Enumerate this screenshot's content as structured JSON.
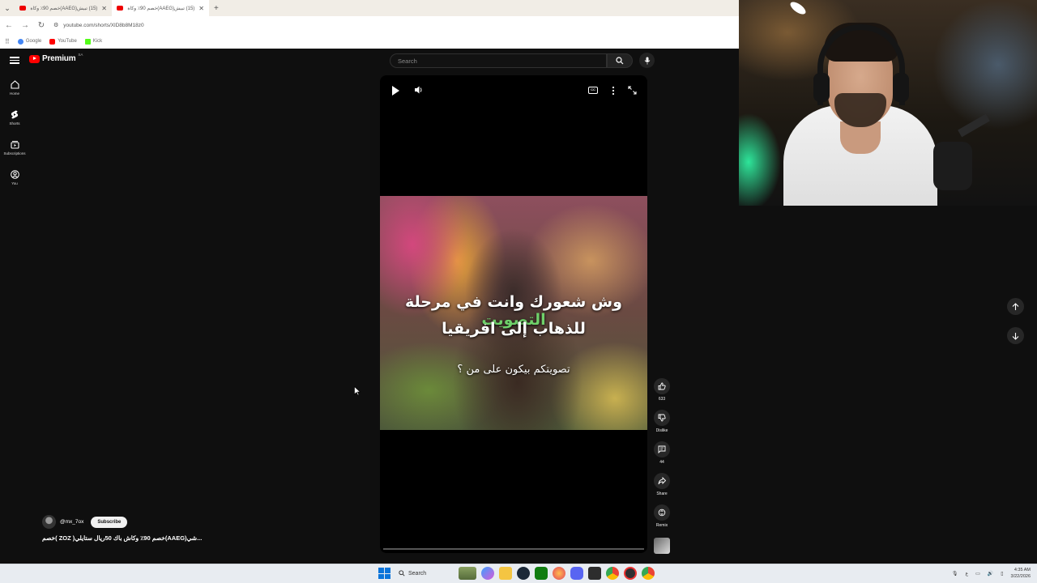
{
  "browser": {
    "tabs": [
      {
        "title": "(15) تبيش(AAEG)خصم 90٪ وكاة"
      },
      {
        "title": "(15) تبيش(AAEG)خصم 90٪ وكاة"
      }
    ],
    "new_tab": "+",
    "url": "youtube.com/shorts/XlD8b8M18z0",
    "bookmarks": [
      {
        "label": "Google",
        "color": "#4285f4"
      },
      {
        "label": "YouTube",
        "color": "#ff0000"
      },
      {
        "label": "Kick",
        "color": "#53fc18"
      }
    ]
  },
  "header": {
    "logo_text": "Premium",
    "region": "SA",
    "search_placeholder": "Search"
  },
  "sidebar": {
    "items": [
      {
        "label": "Home",
        "icon": "home-icon"
      },
      {
        "label": "Shorts",
        "icon": "shorts-icon"
      },
      {
        "label": "Subscriptions",
        "icon": "subscriptions-icon"
      },
      {
        "label": "You",
        "icon": "you-icon"
      }
    ]
  },
  "player": {
    "cc_label": "CC",
    "caption_line1_start": "وش شعورك وانت في مرحلة ",
    "caption_line1_highlight": "التصويت",
    "caption_line2": "للذهاب إلى افريقيا",
    "caption_line3": "تصويتكم بيكون على من ؟",
    "highlight_color": "#6fd06a"
  },
  "actions": {
    "like_count": "633",
    "dislike_label": "Dislike",
    "comment_count": "44",
    "share_label": "Share",
    "remix_label": "Remix"
  },
  "channel": {
    "handle": "@mx_7ox",
    "subscribe_label": "Subscribe",
    "video_title": "...شي(AAEG)خصم 90٪ وكاش باك 50ريال  ستايلي( ZOZ )خصم"
  },
  "taskbar": {
    "search_label": "Search",
    "time": "4:35 AM",
    "date": "3/22/2026"
  }
}
